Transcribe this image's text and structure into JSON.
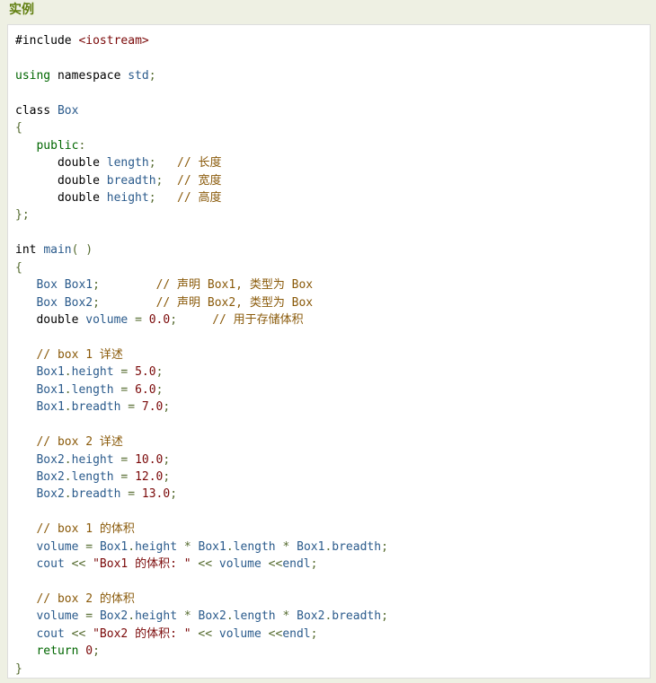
{
  "header": {
    "title": "实例"
  },
  "colors": {
    "title": "#617f10",
    "plain": "#000000",
    "keyword": "#006600",
    "type": "#2b5b8c",
    "literal": "#7a0808",
    "comment": "#8a5a0a",
    "punctuation": "#556b2f"
  },
  "code": {
    "lines": [
      [
        [
          "pln",
          "#include "
        ],
        [
          "str",
          "<iostream>"
        ]
      ],
      [],
      [
        [
          "kw",
          "using"
        ],
        [
          "pln",
          " namespace "
        ],
        [
          "typ",
          "std"
        ],
        [
          "pun",
          ";"
        ]
      ],
      [],
      [
        [
          "pln",
          "class "
        ],
        [
          "typ",
          "Box"
        ]
      ],
      [
        [
          "pun",
          "{"
        ]
      ],
      [
        [
          "pln",
          "   "
        ],
        [
          "kw",
          "public"
        ],
        [
          "pun",
          ":"
        ]
      ],
      [
        [
          "pln",
          "      double "
        ],
        [
          "typ",
          "length"
        ],
        [
          "pun",
          ";"
        ],
        [
          "pln",
          "   "
        ],
        [
          "com",
          "// 长度"
        ]
      ],
      [
        [
          "pln",
          "      double "
        ],
        [
          "typ",
          "breadth"
        ],
        [
          "pun",
          ";"
        ],
        [
          "pln",
          "  "
        ],
        [
          "com",
          "// 宽度"
        ]
      ],
      [
        [
          "pln",
          "      double "
        ],
        [
          "typ",
          "height"
        ],
        [
          "pun",
          ";"
        ],
        [
          "pln",
          "   "
        ],
        [
          "com",
          "// 高度"
        ]
      ],
      [
        [
          "pun",
          "};"
        ]
      ],
      [],
      [
        [
          "pln",
          "int "
        ],
        [
          "typ",
          "main"
        ],
        [
          "pun",
          "( )"
        ]
      ],
      [
        [
          "pun",
          "{"
        ]
      ],
      [
        [
          "pln",
          "   "
        ],
        [
          "typ",
          "Box Box1"
        ],
        [
          "pun",
          ";"
        ],
        [
          "pln",
          "        "
        ],
        [
          "com",
          "// 声明 Box1, 类型为 Box"
        ]
      ],
      [
        [
          "pln",
          "   "
        ],
        [
          "typ",
          "Box Box2"
        ],
        [
          "pun",
          ";"
        ],
        [
          "pln",
          "        "
        ],
        [
          "com",
          "// 声明 Box2, 类型为 Box"
        ]
      ],
      [
        [
          "pln",
          "   double "
        ],
        [
          "typ",
          "volume"
        ],
        [
          "pln",
          " "
        ],
        [
          "pun",
          "="
        ],
        [
          "pln",
          " "
        ],
        [
          "lit",
          "0.0"
        ],
        [
          "pun",
          ";"
        ],
        [
          "pln",
          "     "
        ],
        [
          "com",
          "// 用于存储体积"
        ]
      ],
      [],
      [
        [
          "pln",
          "   "
        ],
        [
          "com",
          "// box 1 详述"
        ]
      ],
      [
        [
          "pln",
          "   "
        ],
        [
          "typ",
          "Box1"
        ],
        [
          "pun",
          "."
        ],
        [
          "typ",
          "height"
        ],
        [
          "pln",
          " "
        ],
        [
          "pun",
          "="
        ],
        [
          "pln",
          " "
        ],
        [
          "lit",
          "5.0"
        ],
        [
          "pun",
          ";"
        ]
      ],
      [
        [
          "pln",
          "   "
        ],
        [
          "typ",
          "Box1"
        ],
        [
          "pun",
          "."
        ],
        [
          "typ",
          "length"
        ],
        [
          "pln",
          " "
        ],
        [
          "pun",
          "="
        ],
        [
          "pln",
          " "
        ],
        [
          "lit",
          "6.0"
        ],
        [
          "pun",
          ";"
        ]
      ],
      [
        [
          "pln",
          "   "
        ],
        [
          "typ",
          "Box1"
        ],
        [
          "pun",
          "."
        ],
        [
          "typ",
          "breadth"
        ],
        [
          "pln",
          " "
        ],
        [
          "pun",
          "="
        ],
        [
          "pln",
          " "
        ],
        [
          "lit",
          "7.0"
        ],
        [
          "pun",
          ";"
        ]
      ],
      [],
      [
        [
          "pln",
          "   "
        ],
        [
          "com",
          "// box 2 详述"
        ]
      ],
      [
        [
          "pln",
          "   "
        ],
        [
          "typ",
          "Box2"
        ],
        [
          "pun",
          "."
        ],
        [
          "typ",
          "height"
        ],
        [
          "pln",
          " "
        ],
        [
          "pun",
          "="
        ],
        [
          "pln",
          " "
        ],
        [
          "lit",
          "10.0"
        ],
        [
          "pun",
          ";"
        ]
      ],
      [
        [
          "pln",
          "   "
        ],
        [
          "typ",
          "Box2"
        ],
        [
          "pun",
          "."
        ],
        [
          "typ",
          "length"
        ],
        [
          "pln",
          " "
        ],
        [
          "pun",
          "="
        ],
        [
          "pln",
          " "
        ],
        [
          "lit",
          "12.0"
        ],
        [
          "pun",
          ";"
        ]
      ],
      [
        [
          "pln",
          "   "
        ],
        [
          "typ",
          "Box2"
        ],
        [
          "pun",
          "."
        ],
        [
          "typ",
          "breadth"
        ],
        [
          "pln",
          " "
        ],
        [
          "pun",
          "="
        ],
        [
          "pln",
          " "
        ],
        [
          "lit",
          "13.0"
        ],
        [
          "pun",
          ";"
        ]
      ],
      [],
      [
        [
          "pln",
          "   "
        ],
        [
          "com",
          "// box 1 的体积"
        ]
      ],
      [
        [
          "pln",
          "   "
        ],
        [
          "typ",
          "volume"
        ],
        [
          "pln",
          " "
        ],
        [
          "pun",
          "="
        ],
        [
          "pln",
          " "
        ],
        [
          "typ",
          "Box1"
        ],
        [
          "pun",
          "."
        ],
        [
          "typ",
          "height"
        ],
        [
          "pln",
          " "
        ],
        [
          "pun",
          "*"
        ],
        [
          "pln",
          " "
        ],
        [
          "typ",
          "Box1"
        ],
        [
          "pun",
          "."
        ],
        [
          "typ",
          "length"
        ],
        [
          "pln",
          " "
        ],
        [
          "pun",
          "*"
        ],
        [
          "pln",
          " "
        ],
        [
          "typ",
          "Box1"
        ],
        [
          "pun",
          "."
        ],
        [
          "typ",
          "breadth"
        ],
        [
          "pun",
          ";"
        ]
      ],
      [
        [
          "pln",
          "   "
        ],
        [
          "typ",
          "cout"
        ],
        [
          "pln",
          " "
        ],
        [
          "pun",
          "<<"
        ],
        [
          "pln",
          " "
        ],
        [
          "str",
          "\"Box1 的体积: \""
        ],
        [
          "pln",
          " "
        ],
        [
          "pun",
          "<<"
        ],
        [
          "pln",
          " "
        ],
        [
          "typ",
          "volume"
        ],
        [
          "pln",
          " "
        ],
        [
          "pun",
          "<<"
        ],
        [
          "typ",
          "endl"
        ],
        [
          "pun",
          ";"
        ]
      ],
      [],
      [
        [
          "pln",
          "   "
        ],
        [
          "com",
          "// box 2 的体积"
        ]
      ],
      [
        [
          "pln",
          "   "
        ],
        [
          "typ",
          "volume"
        ],
        [
          "pln",
          " "
        ],
        [
          "pun",
          "="
        ],
        [
          "pln",
          " "
        ],
        [
          "typ",
          "Box2"
        ],
        [
          "pun",
          "."
        ],
        [
          "typ",
          "height"
        ],
        [
          "pln",
          " "
        ],
        [
          "pun",
          "*"
        ],
        [
          "pln",
          " "
        ],
        [
          "typ",
          "Box2"
        ],
        [
          "pun",
          "."
        ],
        [
          "typ",
          "length"
        ],
        [
          "pln",
          " "
        ],
        [
          "pun",
          "*"
        ],
        [
          "pln",
          " "
        ],
        [
          "typ",
          "Box2"
        ],
        [
          "pun",
          "."
        ],
        [
          "typ",
          "breadth"
        ],
        [
          "pun",
          ";"
        ]
      ],
      [
        [
          "pln",
          "   "
        ],
        [
          "typ",
          "cout"
        ],
        [
          "pln",
          " "
        ],
        [
          "pun",
          "<<"
        ],
        [
          "pln",
          " "
        ],
        [
          "str",
          "\"Box2 的体积: \""
        ],
        [
          "pln",
          " "
        ],
        [
          "pun",
          "<<"
        ],
        [
          "pln",
          " "
        ],
        [
          "typ",
          "volume"
        ],
        [
          "pln",
          " "
        ],
        [
          "pun",
          "<<"
        ],
        [
          "typ",
          "endl"
        ],
        [
          "pun",
          ";"
        ]
      ],
      [
        [
          "pln",
          "   "
        ],
        [
          "kw",
          "return"
        ],
        [
          "pln",
          " "
        ],
        [
          "lit",
          "0"
        ],
        [
          "pun",
          ";"
        ]
      ],
      [
        [
          "pun",
          "}"
        ]
      ]
    ]
  }
}
